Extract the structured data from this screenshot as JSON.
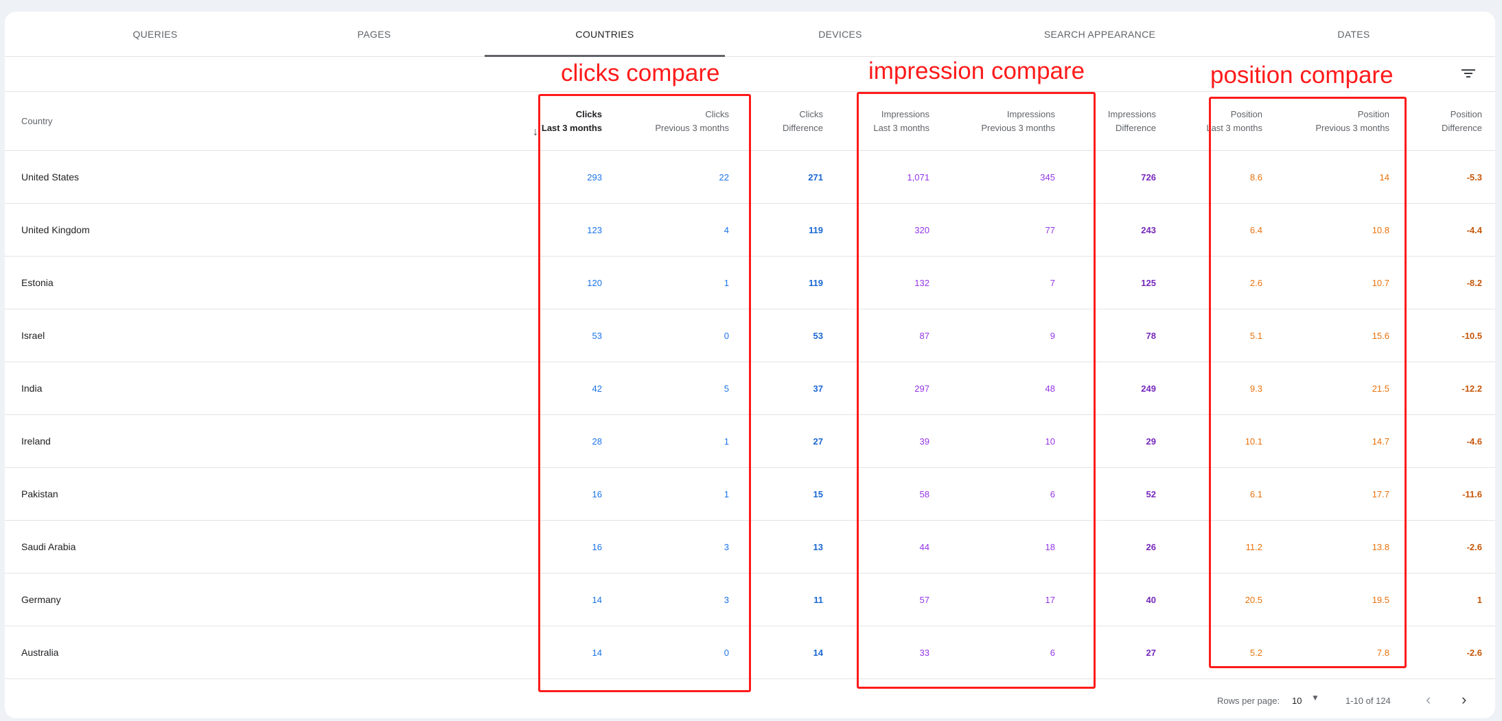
{
  "tabs": [
    "QUERIES",
    "PAGES",
    "COUNTRIES",
    "DEVICES",
    "SEARCH APPEARANCE",
    "DATES"
  ],
  "active_tab": "COUNTRIES",
  "toolbar": {
    "filter_icon": "filter-list-icon"
  },
  "columns": {
    "country": "Country",
    "clicks_last": [
      "Clicks",
      "Last 3 months"
    ],
    "clicks_prev": [
      "Clicks",
      "Previous 3 months"
    ],
    "clicks_diff": [
      "Clicks",
      "Difference"
    ],
    "impr_last": [
      "Impressions",
      "Last 3 months"
    ],
    "impr_prev": [
      "Impressions",
      "Previous 3 months"
    ],
    "impr_diff": [
      "Impressions",
      "Difference"
    ],
    "pos_last": [
      "Position",
      "Last 3 months"
    ],
    "pos_prev": [
      "Position",
      "Previous 3 months"
    ],
    "pos_diff": [
      "Position",
      "Difference"
    ]
  },
  "sorted_column": "clicks_last",
  "rows": [
    {
      "country": "United States",
      "clicks_last": "293",
      "clicks_prev": "22",
      "clicks_diff": "271",
      "impr_last": "1,071",
      "impr_prev": "345",
      "impr_diff": "726",
      "pos_last": "8.6",
      "pos_prev": "14",
      "pos_diff": "-5.3"
    },
    {
      "country": "United Kingdom",
      "clicks_last": "123",
      "clicks_prev": "4",
      "clicks_diff": "119",
      "impr_last": "320",
      "impr_prev": "77",
      "impr_diff": "243",
      "pos_last": "6.4",
      "pos_prev": "10.8",
      "pos_diff": "-4.4"
    },
    {
      "country": "Estonia",
      "clicks_last": "120",
      "clicks_prev": "1",
      "clicks_diff": "119",
      "impr_last": "132",
      "impr_prev": "7",
      "impr_diff": "125",
      "pos_last": "2.6",
      "pos_prev": "10.7",
      "pos_diff": "-8.2"
    },
    {
      "country": "Israel",
      "clicks_last": "53",
      "clicks_prev": "0",
      "clicks_diff": "53",
      "impr_last": "87",
      "impr_prev": "9",
      "impr_diff": "78",
      "pos_last": "5.1",
      "pos_prev": "15.6",
      "pos_diff": "-10.5"
    },
    {
      "country": "India",
      "clicks_last": "42",
      "clicks_prev": "5",
      "clicks_diff": "37",
      "impr_last": "297",
      "impr_prev": "48",
      "impr_diff": "249",
      "pos_last": "9.3",
      "pos_prev": "21.5",
      "pos_diff": "-12.2"
    },
    {
      "country": "Ireland",
      "clicks_last": "28",
      "clicks_prev": "1",
      "clicks_diff": "27",
      "impr_last": "39",
      "impr_prev": "10",
      "impr_diff": "29",
      "pos_last": "10.1",
      "pos_prev": "14.7",
      "pos_diff": "-4.6"
    },
    {
      "country": "Pakistan",
      "clicks_last": "16",
      "clicks_prev": "1",
      "clicks_diff": "15",
      "impr_last": "58",
      "impr_prev": "6",
      "impr_diff": "52",
      "pos_last": "6.1",
      "pos_prev": "17.7",
      "pos_diff": "-11.6"
    },
    {
      "country": "Saudi Arabia",
      "clicks_last": "16",
      "clicks_prev": "3",
      "clicks_diff": "13",
      "impr_last": "44",
      "impr_prev": "18",
      "impr_diff": "26",
      "pos_last": "11.2",
      "pos_prev": "13.8",
      "pos_diff": "-2.6"
    },
    {
      "country": "Germany",
      "clicks_last": "14",
      "clicks_prev": "3",
      "clicks_diff": "11",
      "impr_last": "57",
      "impr_prev": "17",
      "impr_diff": "40",
      "pos_last": "20.5",
      "pos_prev": "19.5",
      "pos_diff": "1"
    },
    {
      "country": "Australia",
      "clicks_last": "14",
      "clicks_prev": "0",
      "clicks_diff": "14",
      "impr_last": "33",
      "impr_prev": "6",
      "impr_diff": "27",
      "pos_last": "5.2",
      "pos_prev": "7.8",
      "pos_diff": "-2.6"
    }
  ],
  "pagination": {
    "rows_per_page_label": "Rows per page:",
    "rows_per_page": "10",
    "range": "1-10 of 124"
  },
  "annotations": [
    "clicks compare",
    "impression compare",
    "position compare"
  ],
  "colors": {
    "clicks": "#1a73e8",
    "impressions": "#9334e6",
    "position": "#e8710a",
    "annotation": "#ff1a1a"
  }
}
